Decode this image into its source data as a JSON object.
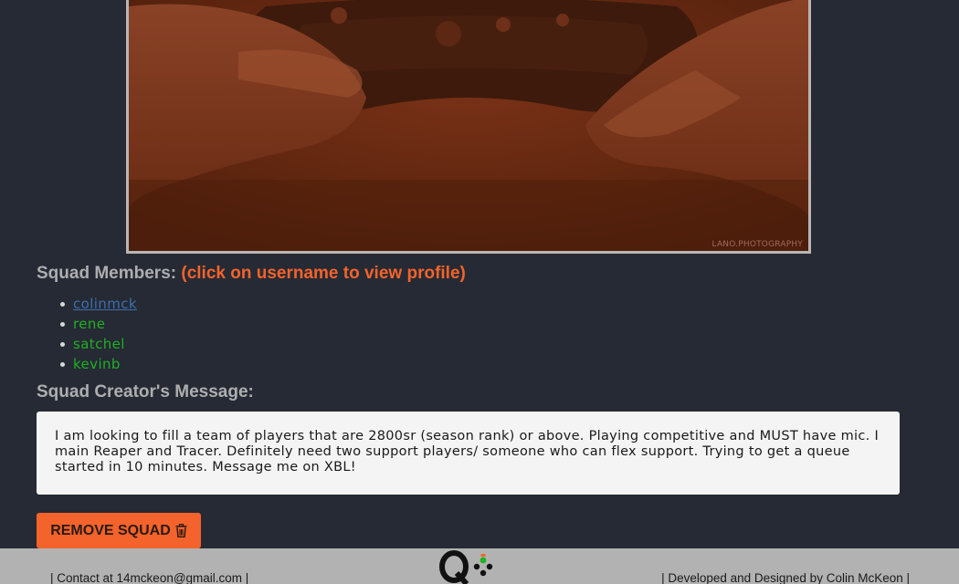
{
  "hero": {
    "watermark": "LANO.PHOTOGRAPHY"
  },
  "members": {
    "heading": "Squad Members:",
    "hint": "(click on username to view profile)",
    "items": [
      {
        "name": "colinmck"
      },
      {
        "name": "rene"
      },
      {
        "name": "satchel"
      },
      {
        "name": "kevinb"
      }
    ]
  },
  "message": {
    "heading": "Squad Creator's Message:",
    "text": "I am looking to fill a team of players that are 2800sr (season rank) or above. Playing competitive and MUST have mic. I main Reaper and Tracer. Definitely need two support players/ someone who can flex support. Trying to get a queue started in 10 minutes. Message me on XBL!"
  },
  "actions": {
    "remove_label": "REMOVE SQUAD",
    "remove_icon": "trash-icon"
  },
  "footer": {
    "contact": "|  Contact at 14mckeon@gmail.com  |",
    "credit": "|  Developed and Designed by Colin McKeon  |",
    "logo_icon": "controller-logo-icon"
  },
  "colors": {
    "background": "#262a34",
    "accent": "#f4632b",
    "link": "#3c6fae",
    "member": "#1fb024",
    "heading": "#aeaeb0",
    "footer_bg": "#b2b2b2"
  }
}
